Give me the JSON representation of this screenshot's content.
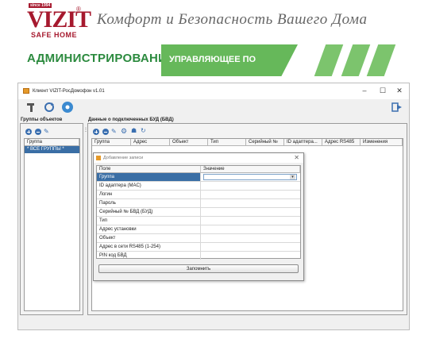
{
  "header": {
    "logo": {
      "since": "since 1994",
      "brand": "VIZIT",
      "reg": "®",
      "sub": "SAFE HOME"
    },
    "slogan": "Комфорт и Безопасность Вашего Дома",
    "admin_title": "АДМИНИСТРИРОВАНИЕ:",
    "admin_banner": "УПРАВЛЯЮЩЕЕ ПО",
    "colors": {
      "brand": "#a6192e",
      "green": "#2b8a3e",
      "banner": "#66b85a"
    }
  },
  "window": {
    "title": "Клиент VIZIT-РосДомофон   v1.01",
    "controls": {
      "minimize": "–",
      "maximize": "☐",
      "close": "✕"
    }
  },
  "left_panel": {
    "title": "Группы объектов",
    "column": "Группа",
    "items": [
      "* ВСЕ ГРУППЫ *"
    ]
  },
  "right_panel": {
    "title": "Данные о подключенных БУД (БВД)",
    "columns": [
      "Группа",
      "Адрес",
      "Объект",
      "Тип",
      "Серийный №",
      "ID адаптера...",
      "Адрес RS485",
      "Изменения"
    ]
  },
  "dialog": {
    "title": "Добавление записи",
    "close": "✕",
    "headers": {
      "field": "Поле",
      "value": "Значение"
    },
    "rows": [
      {
        "label": "Группа"
      },
      {
        "label": "ID адаптера (MAC)"
      },
      {
        "label": "Логин"
      },
      {
        "label": "Пароль"
      },
      {
        "label": "Серийный № БВД (БУД)"
      },
      {
        "label": "Тип"
      },
      {
        "label": "Адрес установки"
      },
      {
        "label": "Объект"
      },
      {
        "label": "Адрес в сети RS485 (1-254)"
      },
      {
        "label": "PIN код БВД"
      }
    ],
    "combo_arrow": "▾",
    "save_label": "Запомнить"
  }
}
